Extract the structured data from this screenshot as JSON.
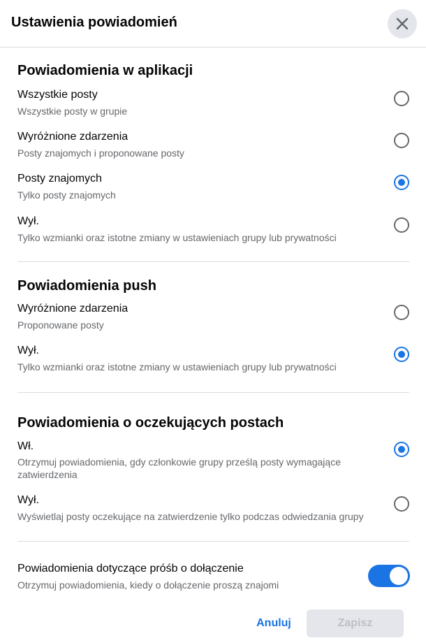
{
  "header": {
    "title": "Ustawienia powiadomień",
    "close_icon": "close-icon"
  },
  "sections": [
    {
      "title": "Powiadomienia w aplikacji",
      "options": [
        {
          "label": "Wszystkie posty",
          "desc": "Wszystkie posty w grupie",
          "checked": false
        },
        {
          "label": "Wyróżnione zdarzenia",
          "desc": "Posty znajomych i proponowane posty",
          "checked": false
        },
        {
          "label": "Posty znajomych",
          "desc": "Tylko posty znajomych",
          "checked": true
        },
        {
          "label": "Wył.",
          "desc": "Tylko wzmianki oraz istotne zmiany w ustawieniach grupy lub prywatności",
          "checked": false
        }
      ]
    },
    {
      "title": "Powiadomienia push",
      "options": [
        {
          "label": "Wyróżnione zdarzenia",
          "desc": "Proponowane posty",
          "checked": false
        },
        {
          "label": "Wył.",
          "desc": "Tylko wzmianki oraz istotne zmiany w ustawieniach grupy lub prywatności",
          "checked": true
        }
      ]
    },
    {
      "title": "Powiadomienia o oczekujących postach",
      "options": [
        {
          "label": "Wł.",
          "desc": "Otrzymuj powiadomienia, gdy członkowie grupy prześlą posty wymagające zatwierdzenia",
          "checked": true
        },
        {
          "label": "Wył.",
          "desc": "Wyświetlaj posty oczekujące na zatwierdzenie tylko podczas odwiedzania grupy",
          "checked": false
        }
      ]
    }
  ],
  "join_requests": {
    "label": "Powiadomienia dotyczące próśb o dołączenie",
    "desc": "Otrzymuj powiadomienia, kiedy o dołączenie proszą znajomi",
    "enabled": true
  },
  "footer": {
    "cancel_label": "Anuluj",
    "save_label": "Zapisz"
  },
  "colors": {
    "accent": "#1b74e4",
    "secondary_text": "#65676b",
    "divider": "#dadde1"
  }
}
